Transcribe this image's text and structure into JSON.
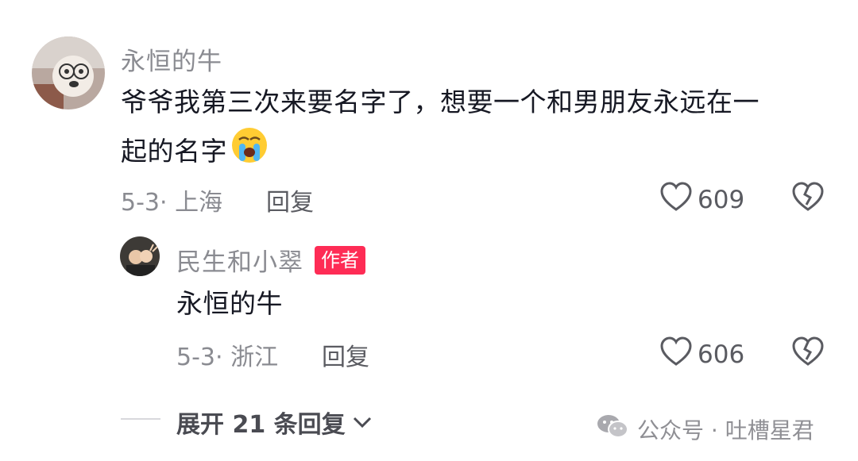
{
  "comment": {
    "username": "永恒的牛",
    "text_line1": "爷爷我第三次来要名字了，想要一个和男朋友永远在一",
    "text_line2": "起的名字",
    "emoji": "😭",
    "date": "5-3",
    "separator": "·",
    "location": "上海",
    "reply_label": "回复",
    "likes": "609"
  },
  "reply": {
    "username": "民生和小翠",
    "author_badge": "作者",
    "text": "永恒的牛",
    "date": "5-3",
    "separator": "·",
    "location": "浙江",
    "reply_label": "回复",
    "likes": "606"
  },
  "expand_replies": {
    "label": "展开 21 条回复"
  },
  "watermark": {
    "label": "公众号 · 吐槽星君"
  },
  "icons": {
    "like": "heart-outline-icon",
    "dislike": "broken-heart-icon",
    "expand": "chevron-down-icon",
    "watermark": "wechat-icon"
  },
  "colors": {
    "badge": "#fe2c55",
    "text": "#161823",
    "muted": "#8a8b91"
  }
}
